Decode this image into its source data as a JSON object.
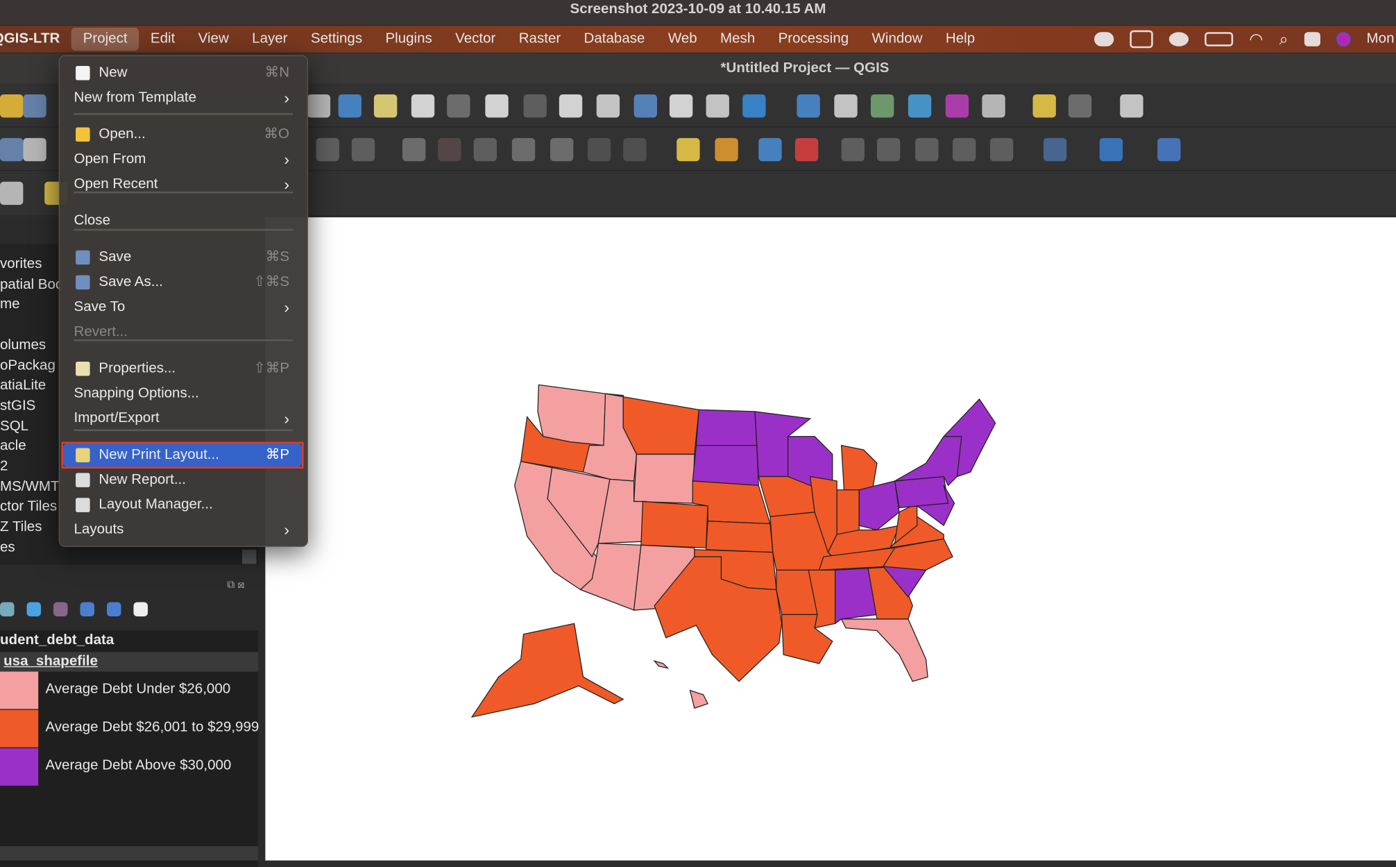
{
  "os_title": "Screenshot 2023-10-09 at 10.40.15 AM",
  "app_name": "QGIS-LTR",
  "menubar": [
    "Project",
    "Edit",
    "View",
    "Layer",
    "Settings",
    "Plugins",
    "Vector",
    "Raster",
    "Database",
    "Web",
    "Mesh",
    "Processing",
    "Window",
    "Help"
  ],
  "menubar_right_clock": "Mon",
  "window_title": "*Untitled Project — QGIS",
  "project_menu": {
    "items": [
      {
        "label": "New",
        "shortcut": "⌘N",
        "icon": "new-file-icon"
      },
      {
        "label": "New from Template",
        "submenu": true
      },
      {
        "label": "Open...",
        "shortcut": "⌘O",
        "icon": "folder-icon"
      },
      {
        "label": "Open From",
        "submenu": true
      },
      {
        "label": "Open Recent",
        "submenu": true
      },
      {
        "label": "Close"
      },
      {
        "label": "Save",
        "shortcut": "⌘S",
        "icon": "save-icon"
      },
      {
        "label": "Save As...",
        "shortcut": "⇧⌘S",
        "icon": "save-as-icon"
      },
      {
        "label": "Save To",
        "submenu": true
      },
      {
        "label": "Revert...",
        "disabled": true
      },
      {
        "label": "Properties...",
        "shortcut": "⇧⌘P",
        "icon": "properties-icon"
      },
      {
        "label": "Snapping Options..."
      },
      {
        "label": "Import/Export",
        "submenu": true
      },
      {
        "label": "New Print Layout...",
        "shortcut": "⌘P",
        "icon": "print-layout-icon",
        "highlighted": true
      },
      {
        "label": "New Report...",
        "icon": "report-icon"
      },
      {
        "label": "Layout Manager...",
        "icon": "layout-manager-icon"
      },
      {
        "label": "Layouts",
        "submenu": true
      }
    ]
  },
  "browser": {
    "items": [
      "vorites",
      "patial Boo",
      "me",
      "",
      "olumes",
      "oPackag",
      "atiaLite",
      "stGIS",
      "SQL",
      "acle",
      "2",
      "MS/WMT",
      "ctor Tiles",
      "Z Tiles",
      "es"
    ]
  },
  "layers": {
    "group": "udent_debt_data",
    "layer": "usa_shapefile",
    "legend": [
      {
        "label": "Average Debt Under $26,000",
        "color": "#f4a0a0"
      },
      {
        "label": "Average Debt $26,001 to $29,999",
        "color": "#f05a28"
      },
      {
        "label": "Average Debt Above $30,000",
        "color": "#9b30c8"
      }
    ]
  },
  "colors": {
    "low": "#f4a0a0",
    "mid": "#f05a28",
    "high": "#9b30c8",
    "highlight": "#3563c9"
  }
}
